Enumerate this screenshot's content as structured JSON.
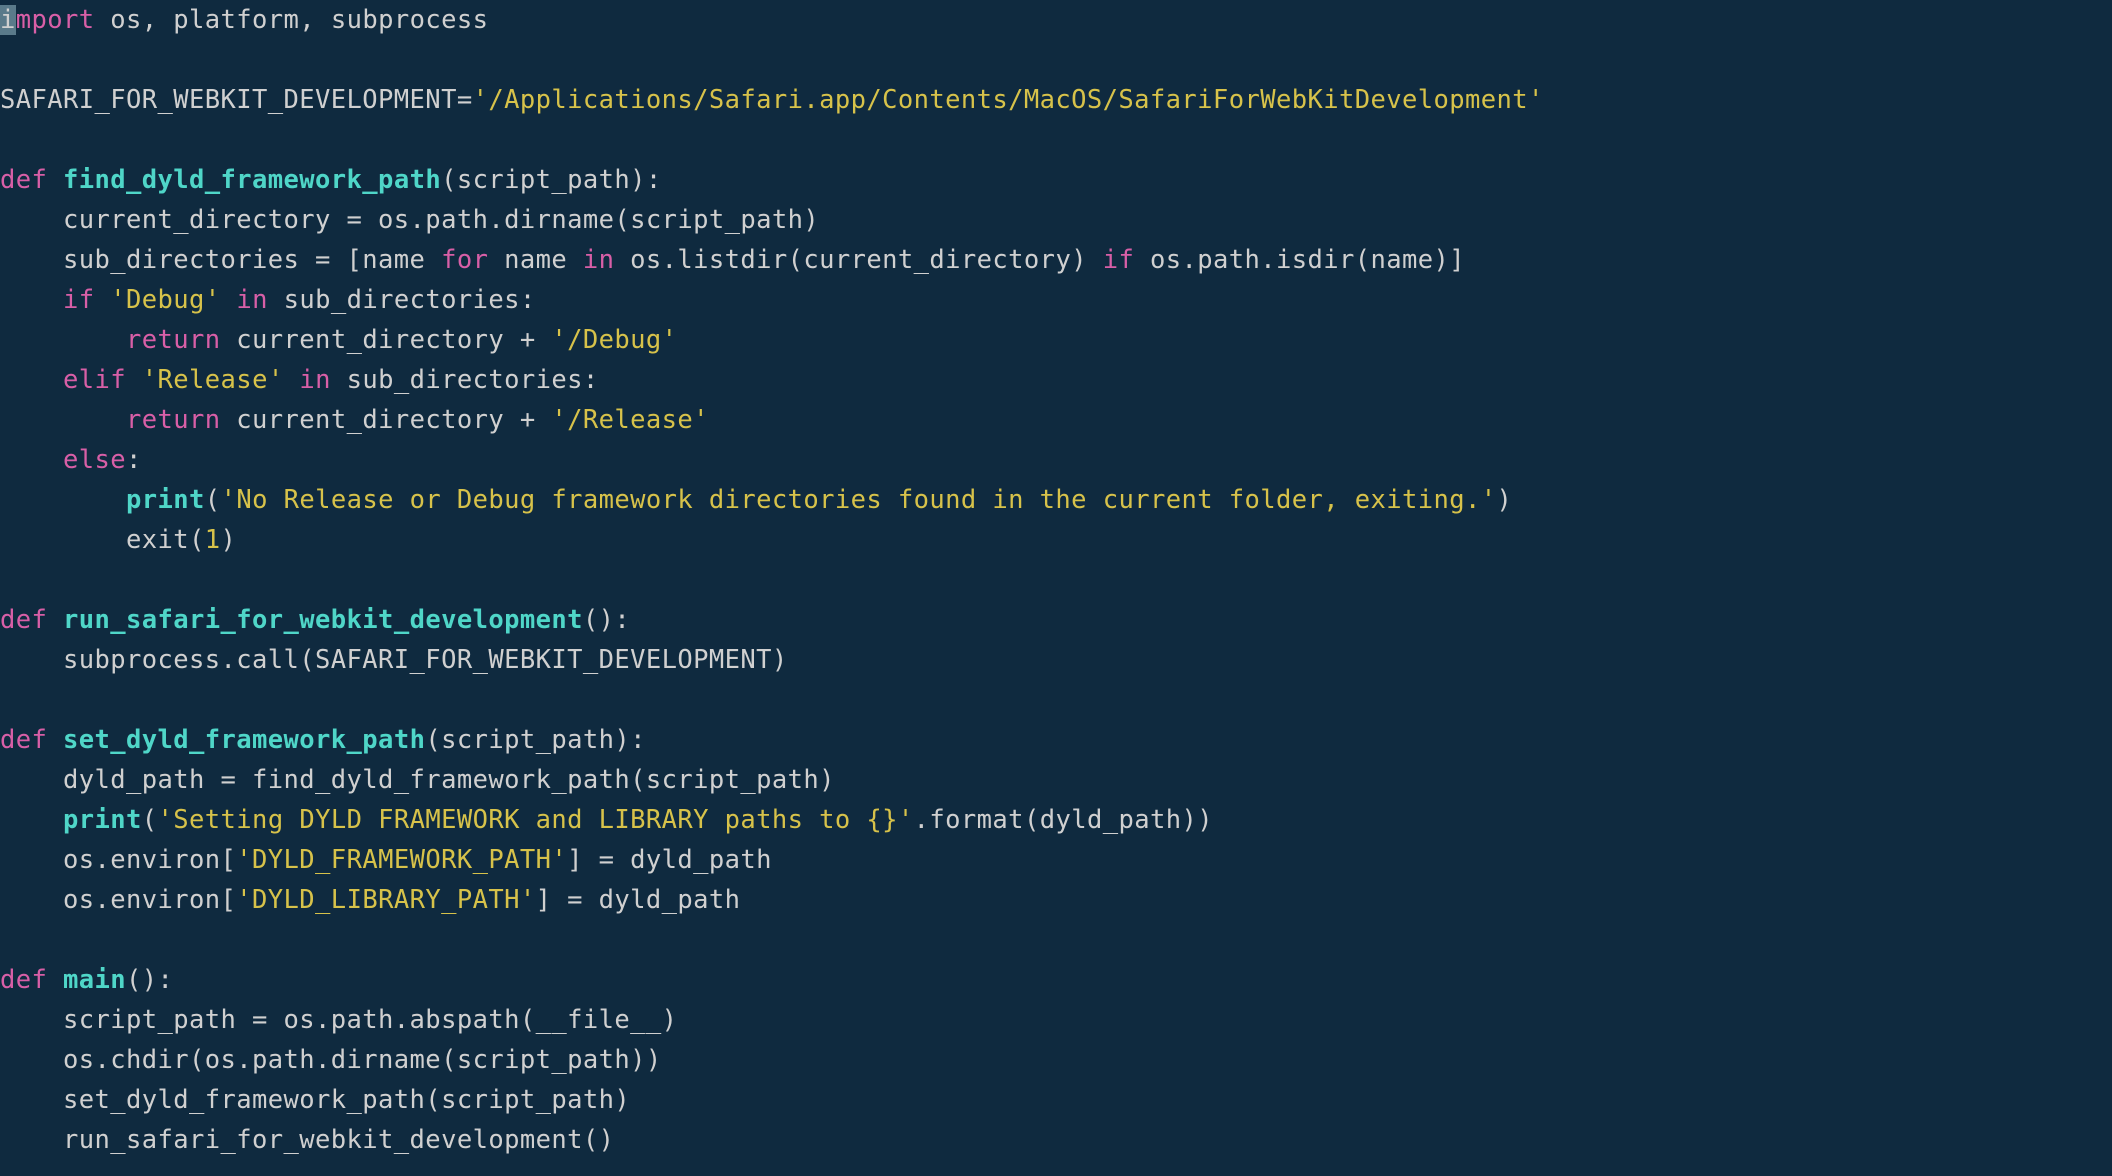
{
  "code": {
    "lines": [
      [
        {
          "t": "i",
          "cls": "kw cursor"
        },
        {
          "t": "mport",
          "cls": "kw"
        },
        {
          "t": " os, platform, subprocess",
          "cls": "id"
        }
      ],
      [],
      [
        {
          "t": "SAFARI_FOR_WEBKIT_DEVELOPMENT=",
          "cls": "id"
        },
        {
          "t": "'/Applications/Safari.app/Contents/MacOS/SafariForWebKitDevelopment'",
          "cls": "str"
        }
      ],
      [],
      [
        {
          "t": "def ",
          "cls": "kw"
        },
        {
          "t": "find_dyld_framework_path",
          "cls": "fn"
        },
        {
          "t": "(script_path):",
          "cls": "id"
        }
      ],
      [
        {
          "t": "    current_directory = os.path.dirname(script_path)",
          "cls": "id"
        }
      ],
      [
        {
          "t": "    sub_directories = [name ",
          "cls": "id"
        },
        {
          "t": "for",
          "cls": "kw"
        },
        {
          "t": " name ",
          "cls": "id"
        },
        {
          "t": "in",
          "cls": "kw"
        },
        {
          "t": " os.listdir(current_directory) ",
          "cls": "id"
        },
        {
          "t": "if",
          "cls": "kw"
        },
        {
          "t": " os.path.isdir(name)]",
          "cls": "id"
        }
      ],
      [
        {
          "t": "    ",
          "cls": "id"
        },
        {
          "t": "if",
          "cls": "kw"
        },
        {
          "t": " ",
          "cls": "id"
        },
        {
          "t": "'Debug'",
          "cls": "str"
        },
        {
          "t": " ",
          "cls": "id"
        },
        {
          "t": "in",
          "cls": "kw"
        },
        {
          "t": " sub_directories:",
          "cls": "id"
        }
      ],
      [
        {
          "t": "        ",
          "cls": "id"
        },
        {
          "t": "return",
          "cls": "kw"
        },
        {
          "t": " current_directory + ",
          "cls": "id"
        },
        {
          "t": "'/Debug'",
          "cls": "str"
        }
      ],
      [
        {
          "t": "    ",
          "cls": "id"
        },
        {
          "t": "elif",
          "cls": "kw"
        },
        {
          "t": " ",
          "cls": "id"
        },
        {
          "t": "'Release'",
          "cls": "str"
        },
        {
          "t": " ",
          "cls": "id"
        },
        {
          "t": "in",
          "cls": "kw"
        },
        {
          "t": " sub_directories:",
          "cls": "id"
        }
      ],
      [
        {
          "t": "        ",
          "cls": "id"
        },
        {
          "t": "return",
          "cls": "kw"
        },
        {
          "t": " current_directory + ",
          "cls": "id"
        },
        {
          "t": "'/Release'",
          "cls": "str"
        }
      ],
      [
        {
          "t": "    ",
          "cls": "id"
        },
        {
          "t": "else",
          "cls": "kw"
        },
        {
          "t": ":",
          "cls": "id"
        }
      ],
      [
        {
          "t": "        ",
          "cls": "id"
        },
        {
          "t": "print",
          "cls": "bi"
        },
        {
          "t": "(",
          "cls": "id"
        },
        {
          "t": "'No Release or Debug framework directories found in the current folder, exiting.'",
          "cls": "str"
        },
        {
          "t": ")",
          "cls": "id"
        }
      ],
      [
        {
          "t": "        exit(",
          "cls": "id"
        },
        {
          "t": "1",
          "cls": "num"
        },
        {
          "t": ")",
          "cls": "id"
        }
      ],
      [],
      [
        {
          "t": "def ",
          "cls": "kw"
        },
        {
          "t": "run_safari_for_webkit_development",
          "cls": "fn"
        },
        {
          "t": "():",
          "cls": "id"
        }
      ],
      [
        {
          "t": "    subprocess.call(SAFARI_FOR_WEBKIT_DEVELOPMENT)",
          "cls": "id"
        }
      ],
      [],
      [
        {
          "t": "def ",
          "cls": "kw"
        },
        {
          "t": "set_dyld_framework_path",
          "cls": "fn"
        },
        {
          "t": "(script_path):",
          "cls": "id"
        }
      ],
      [
        {
          "t": "    dyld_path = find_dyld_framework_path(script_path)",
          "cls": "id"
        }
      ],
      [
        {
          "t": "    ",
          "cls": "id"
        },
        {
          "t": "print",
          "cls": "bi"
        },
        {
          "t": "(",
          "cls": "id"
        },
        {
          "t": "'Setting DYLD FRAMEWORK and LIBRARY paths to {}'",
          "cls": "str"
        },
        {
          "t": ".format(dyld_path))",
          "cls": "id"
        }
      ],
      [
        {
          "t": "    os.environ[",
          "cls": "id"
        },
        {
          "t": "'DYLD_FRAMEWORK_PATH'",
          "cls": "str"
        },
        {
          "t": "] = dyld_path",
          "cls": "id"
        }
      ],
      [
        {
          "t": "    os.environ[",
          "cls": "id"
        },
        {
          "t": "'DYLD_LIBRARY_PATH'",
          "cls": "str"
        },
        {
          "t": "] = dyld_path",
          "cls": "id"
        }
      ],
      [],
      [
        {
          "t": "def ",
          "cls": "kw"
        },
        {
          "t": "main",
          "cls": "fn"
        },
        {
          "t": "():",
          "cls": "id"
        }
      ],
      [
        {
          "t": "    script_path = os.path.abspath(__file__)",
          "cls": "id"
        }
      ],
      [
        {
          "t": "    os.chdir(os.path.dirname(script_path))",
          "cls": "id"
        }
      ],
      [
        {
          "t": "    set_dyld_framework_path(script_path)",
          "cls": "id"
        }
      ],
      [
        {
          "t": "    run_safari_for_webkit_development()",
          "cls": "id"
        }
      ]
    ]
  }
}
